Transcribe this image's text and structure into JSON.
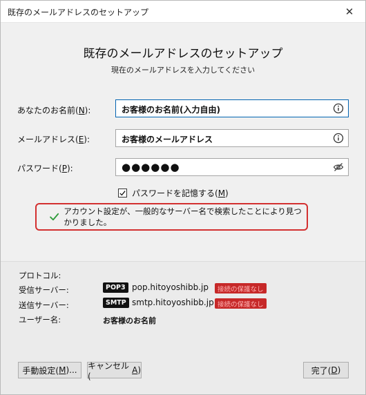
{
  "window": {
    "title": "既存のメールアドレスのセットアップ",
    "close_glyph": "✕"
  },
  "header": {
    "title": "既存のメールアドレスのセットアップ",
    "subtitle": "現在のメールアドレスを入力してください"
  },
  "form": {
    "name": {
      "label_pre": "あなたのお名前(",
      "label_key": "N",
      "label_post": "):",
      "value": "お客様のお名前(入力自由)"
    },
    "email": {
      "label_pre": "メールアドレス(",
      "label_key": "E",
      "label_post": "):",
      "value": "お客様のメールアドレス"
    },
    "password": {
      "label_pre": "パスワード(",
      "label_key": "P",
      "label_post": "):",
      "value": "●●●●●●"
    },
    "remember": {
      "label_pre": "パスワードを記憶する(",
      "label_key": "M",
      "label_post": ")",
      "checked": true
    }
  },
  "status": {
    "message": "アカウント設定が、一般的なサーバー名で検索したことにより見つかりました。",
    "check_color": "#2e9b3a",
    "border_color": "#d32f2f"
  },
  "server_info": {
    "protocol_label": "プロトコル:",
    "incoming_label": "受信サーバー:",
    "incoming_protocol": "POP3",
    "incoming_host": "pop.hitoyoshibb.jp",
    "incoming_warning": "接続の保護なし",
    "outgoing_label": "送信サーバー:",
    "outgoing_protocol": "SMTP",
    "outgoing_host": "smtp.hitoyoshibb.jp",
    "outgoing_warning": "接続の保護なし",
    "username_label": "ユーザー名:",
    "username_value": "お客様のお名前"
  },
  "buttons": {
    "manual": {
      "pre": "手動設定(",
      "key": "M",
      "post": ")..."
    },
    "cancel": {
      "pre": "キャンセル(",
      "key": "A",
      "post": ")"
    },
    "done": {
      "pre": "完了(",
      "key": "D",
      "post": ")"
    }
  }
}
